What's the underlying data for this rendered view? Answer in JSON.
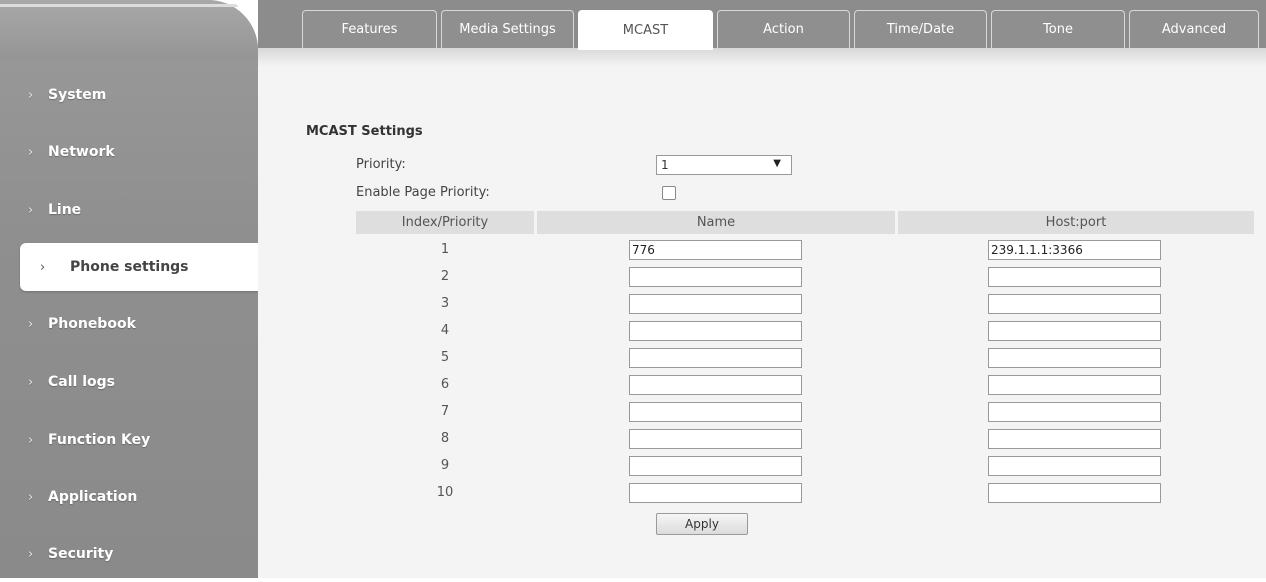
{
  "sidebar": {
    "items": [
      {
        "label": "System"
      },
      {
        "label": "Network"
      },
      {
        "label": "Line"
      },
      {
        "label": "Phone settings"
      },
      {
        "label": "Phonebook"
      },
      {
        "label": "Call logs"
      },
      {
        "label": "Function Key"
      },
      {
        "label": "Application"
      },
      {
        "label": "Security"
      }
    ]
  },
  "tabs": [
    {
      "label": "Features"
    },
    {
      "label": "Media Settings"
    },
    {
      "label": "MCAST"
    },
    {
      "label": "Action"
    },
    {
      "label": "Time/Date"
    },
    {
      "label": "Tone"
    },
    {
      "label": "Advanced"
    }
  ],
  "mcast": {
    "section_title": "MCAST Settings",
    "priority_label": "Priority:",
    "priority_value": "1",
    "enable_page_priority_label": "Enable Page Priority:",
    "enable_page_priority_checked": false,
    "columns": [
      "Index/Priority",
      "Name",
      "Host:port"
    ],
    "rows": [
      {
        "index": "1",
        "name": "776",
        "host": "239.1.1.1:3366"
      },
      {
        "index": "2",
        "name": "",
        "host": ""
      },
      {
        "index": "3",
        "name": "",
        "host": ""
      },
      {
        "index": "4",
        "name": "",
        "host": ""
      },
      {
        "index": "5",
        "name": "",
        "host": ""
      },
      {
        "index": "6",
        "name": "",
        "host": ""
      },
      {
        "index": "7",
        "name": "",
        "host": ""
      },
      {
        "index": "8",
        "name": "",
        "host": ""
      },
      {
        "index": "9",
        "name": "",
        "host": ""
      },
      {
        "index": "10",
        "name": "",
        "host": ""
      }
    ],
    "apply_label": "Apply"
  }
}
